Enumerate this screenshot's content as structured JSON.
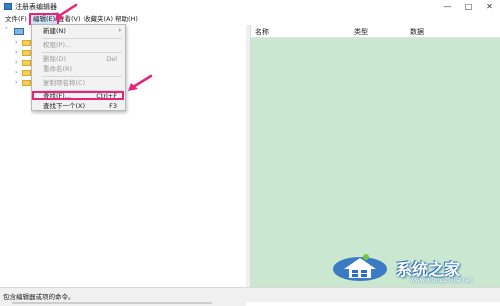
{
  "window": {
    "title": "注册表编辑器",
    "controls": [
      "—",
      "□",
      "✕"
    ]
  },
  "menubar": {
    "items": [
      "文件(F)",
      "编辑(E)",
      "查看(V)",
      "收藏夹(A)",
      "帮助(H)"
    ]
  },
  "edit_menu": {
    "items": [
      {
        "label": "新建(N)",
        "shortcut": "",
        "submenu": true,
        "disabled": false
      },
      {
        "label": "权限(P)...",
        "shortcut": "",
        "submenu": false,
        "disabled": true
      },
      {
        "label": "删除(D)",
        "shortcut": "Del",
        "submenu": false,
        "disabled": true
      },
      {
        "label": "重命名(R)",
        "shortcut": "",
        "submenu": false,
        "disabled": true
      },
      {
        "label": "复制项名称(C)",
        "shortcut": "",
        "submenu": false,
        "disabled": true
      },
      {
        "label": "查找(F)...",
        "shortcut": "Ctrl+F",
        "submenu": false,
        "disabled": false
      },
      {
        "label": "查找下一个(X)",
        "shortcut": "F3",
        "submenu": false,
        "disabled": false
      }
    ]
  },
  "list": {
    "columns": [
      "名称",
      "类型",
      "数据"
    ]
  },
  "statusbar": {
    "text": "包含编辑器或项的命令。"
  },
  "watermark": {
    "text": "系统之家",
    "url": "www.xitongzhijia.net"
  },
  "colors": {
    "highlight": "#e8247a",
    "list_background": "#c9e8cf"
  }
}
